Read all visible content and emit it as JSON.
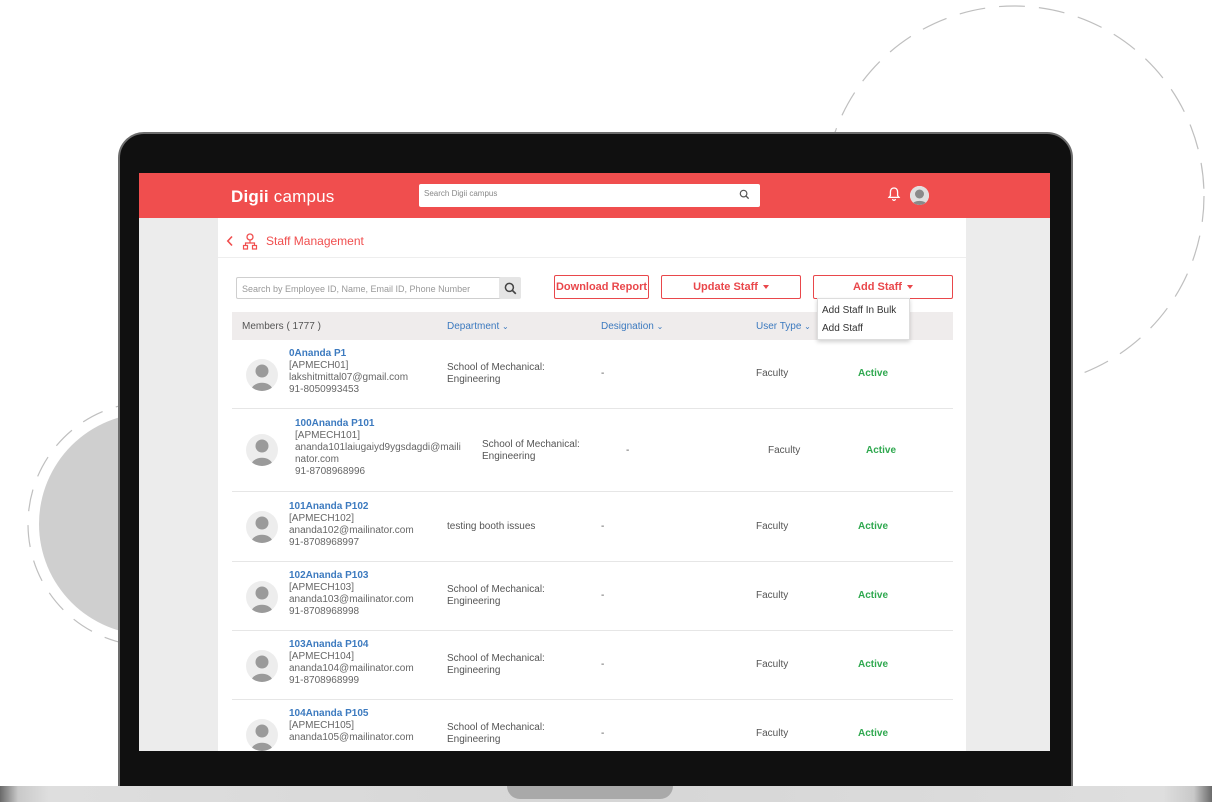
{
  "app": {
    "logo_bold": "Digii",
    "logo_light": " campus",
    "search_placeholder": "Search Digii campus"
  },
  "page": {
    "title": "Staff Management"
  },
  "toolbar": {
    "search_placeholder": "Search by Employee ID, Name, Email ID, Phone Number",
    "download_label": "Download Report",
    "update_label": "Update Staff",
    "add_label": "Add Staff"
  },
  "dropdown": {
    "items": [
      "Add Staff In Bulk",
      "Add Staff"
    ]
  },
  "table": {
    "members_label": "Members ( 1777 )",
    "columns": [
      "Department",
      "Designation",
      "User Type"
    ],
    "rows": [
      {
        "name": "0Ananda P1",
        "id": "[APMECH01]",
        "email": "lakshitmittal07@gmail.com",
        "phone": "91-8050993453",
        "dept1": "School of Mechanical:",
        "dept2": "Engineering",
        "designation": "-",
        "user_type": "Faculty",
        "status": "Active"
      },
      {
        "name": "100Ananda P101",
        "id": "[APMECH101]",
        "email": "ananda101laiugaiyd9ygsdagdi@maili",
        "email2": "nator.com",
        "phone": "91-8708968996",
        "dept1": "School of Mechanical:",
        "dept2": "Engineering",
        "designation": "-",
        "user_type": "Faculty",
        "status": "Active"
      },
      {
        "name": "101Ananda P102",
        "id": "[APMECH102]",
        "email": "ananda102@mailinator.com",
        "phone": "91-8708968997",
        "dept1": "testing booth issues",
        "dept2": "",
        "designation": "-",
        "user_type": "Faculty",
        "status": "Active"
      },
      {
        "name": "102Ananda P103",
        "id": "[APMECH103]",
        "email": "ananda103@mailinator.com",
        "phone": "91-8708968998",
        "dept1": "School of Mechanical:",
        "dept2": "Engineering",
        "designation": "-",
        "user_type": "Faculty",
        "status": "Active"
      },
      {
        "name": "103Ananda P104",
        "id": "[APMECH104]",
        "email": "ananda104@mailinator.com",
        "phone": "91-8708968999",
        "dept1": "School of Mechanical:",
        "dept2": "Engineering",
        "designation": "-",
        "user_type": "Faculty",
        "status": "Active"
      },
      {
        "name": "104Ananda P105",
        "id": "[APMECH105]",
        "email": "ananda105@mailinator.com",
        "phone": "",
        "dept1": "School of Mechanical:",
        "dept2": "Engineering",
        "designation": "-",
        "user_type": "Faculty",
        "status": "Active"
      }
    ]
  },
  "icons": {
    "search": "search-icon",
    "bell": "bell-icon",
    "back": "chevron-left-icon",
    "org": "org-chart-icon",
    "avatar": "avatar-icon"
  },
  "colors": {
    "brand": "#f04e4e",
    "link": "#3c7abf",
    "active": "#2fa84f"
  }
}
